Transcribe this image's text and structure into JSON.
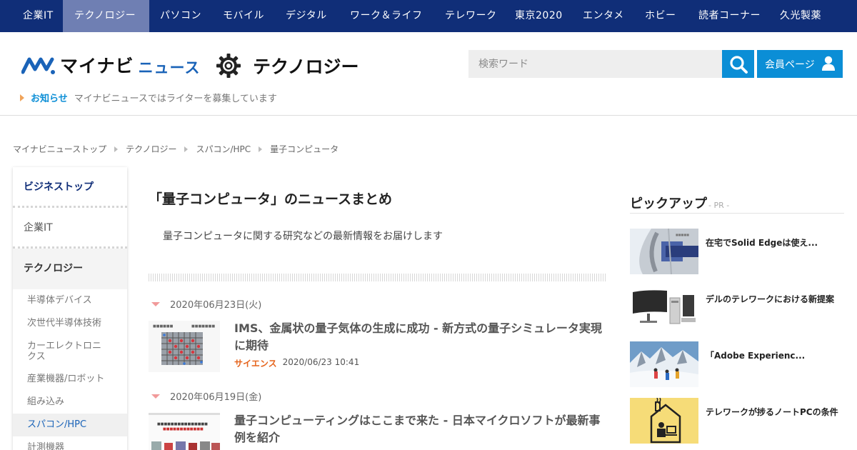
{
  "topnav": {
    "items": [
      "企業IT",
      "テクノロジー",
      "パソコン",
      "モバイル",
      "デジタル",
      "ワーク＆ライフ",
      "テレワーク",
      "東京2020",
      "エンタメ",
      "ホビー",
      "読者コーナー",
      "久光製薬"
    ],
    "active_index": 1
  },
  "header": {
    "logo_text": "マイナビ",
    "logo_suffix": "ニュース",
    "section_title": "テクノロジー",
    "search_placeholder": "検索ワード",
    "member_label": "会員ページ",
    "notice_label": "お知らせ",
    "notice_text": "マイナビニュースではライターを募集しています"
  },
  "breadcrumb": [
    "マイナビニューストップ",
    "テクノロジー",
    "スパコン/HPC",
    "量子コンピュータ"
  ],
  "sidebar": {
    "main": [
      "ビジネストップ",
      "企業IT",
      "テクノロジー"
    ],
    "sub": [
      "半導体デバイス",
      "次世代半導体技術",
      "カーエレクトロニクス",
      "産業機器/ロボット",
      "組み込み",
      "スパコン/HPC",
      "計測機器"
    ],
    "current_sub": "スパコン/HPC"
  },
  "main": {
    "title": "「量子コンピュータ」のニュースまとめ",
    "description": "量子コンピュータに関する研究などの最新情報をお届けします",
    "articles": [
      {
        "date": "2020年06月23日(火)",
        "title": "IMS、金属状の量子気体の生成に成功 - 新方式の量子シミュレータ実現に期待",
        "category": "サイエンス",
        "time": "2020/06/23 10:41"
      },
      {
        "date": "2020年06月19日(金)",
        "title": "量子コンピューティングはここまで来た - 日本マイクロソフトが最新事例を紹介"
      }
    ]
  },
  "pickup": {
    "title": "ピックアップ",
    "pr": "- PR -",
    "items": [
      "在宅でSolid Edgeは使え...",
      "デルのテレワークにおける新提案",
      "「Adobe Experienc...",
      "テレワークが捗るノートPCの条件"
    ]
  },
  "colors": {
    "nav_bg": "#102e78",
    "nav_active": "#6f7fb3",
    "accent_blue": "#0b8ed6",
    "category_orange": "#e5631b"
  }
}
